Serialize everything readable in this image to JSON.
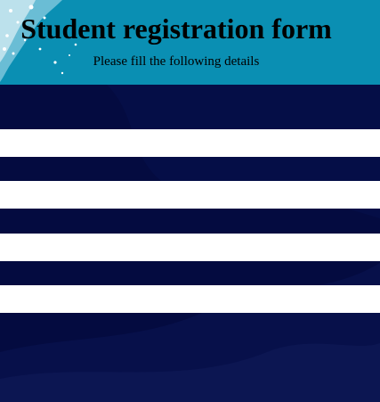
{
  "header": {
    "title": "Student registration form",
    "subtitle": "Please fill the following details"
  },
  "form": {
    "fields": [
      {
        "value": "",
        "placeholder": ""
      },
      {
        "value": "",
        "placeholder": ""
      },
      {
        "value": "",
        "placeholder": ""
      },
      {
        "value": "",
        "placeholder": ""
      }
    ]
  },
  "colors": {
    "header_bg": "#0a8fb3",
    "form_bg": "#040b40",
    "field_bg": "#ffffff"
  }
}
